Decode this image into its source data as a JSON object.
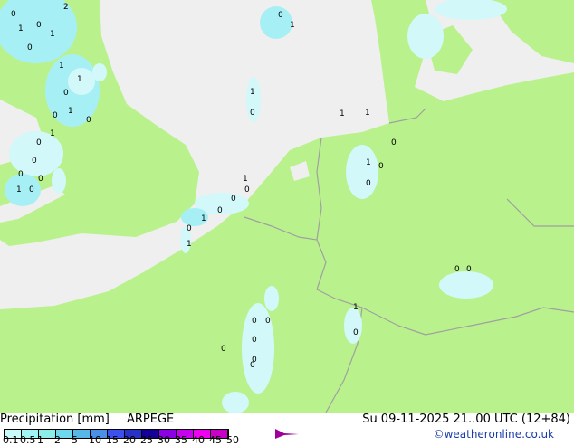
{
  "colors": {
    "land": "#b9f28c",
    "sea": "#efefef",
    "border": "#a0a0a0",
    "precip_light": "#d2f8fa",
    "precip_med": "#a6f0f5"
  },
  "legend": {
    "title": "Precipitation [mm]",
    "model": "ARPEGE",
    "datetime": "Su 09-11-2025 21..00 UTC (12+84)",
    "credit": "©weatheronline.co.uk",
    "ticks": [
      "0.1",
      "0.5",
      "1",
      "2",
      "5",
      "10",
      "15",
      "20",
      "25",
      "30",
      "35",
      "40",
      "45",
      "50"
    ],
    "scale_colors": [
      "#c8fafa",
      "#a0f5f5",
      "#8ceee8",
      "#6ed8ec",
      "#55b8e6",
      "#4a90e6",
      "#3c50f0",
      "#2832c8",
      "#140096",
      "#8c00e6",
      "#c800f0",
      "#f000f0",
      "#c800c8"
    ],
    "overflow_color": "#a0009a"
  },
  "map_labels": [
    "0",
    "1",
    "0",
    "1",
    "2",
    "0",
    "1",
    "1",
    "0",
    "0",
    "1",
    "0",
    "0",
    "1",
    "0",
    "0",
    "1",
    "0",
    "0",
    "1",
    "0",
    "0",
    "0",
    "1",
    "0",
    "1",
    "1",
    "0",
    "0",
    "1",
    "1",
    "1",
    "1",
    "0",
    "0",
    "0",
    "0",
    "0",
    "0",
    "0",
    "0",
    "0",
    "1",
    "0",
    "0",
    "0"
  ]
}
